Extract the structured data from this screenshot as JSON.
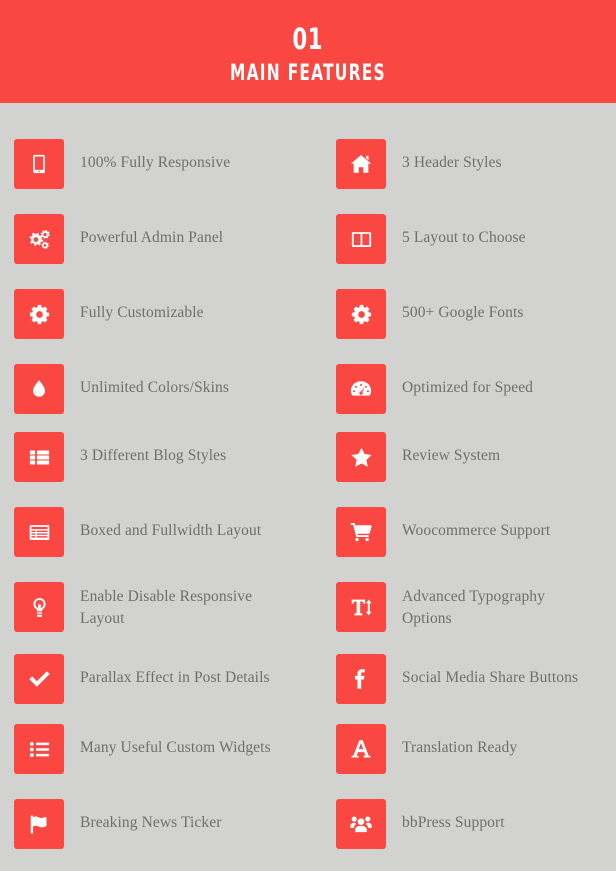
{
  "header": {
    "number": "01",
    "title": "MAIN FEATURES",
    "background_color": "#fb4742",
    "text_color": "#ffffff"
  },
  "theme": {
    "page_background": "#d2d2d0",
    "accent": "#fb4742",
    "label_color": "#6f6f6f"
  },
  "features": {
    "left_column": [
      {
        "label": "100% Fully Responsive",
        "icon": "tablet-icon",
        "two_line": false
      },
      {
        "label": "Powerful Admin Panel",
        "icon": "cogs-icon",
        "two_line": false
      },
      {
        "label": "Fully Customizable",
        "icon": "gear-icon",
        "two_line": false
      },
      {
        "label": "Unlimited Colors/Skins",
        "icon": "droplet-icon",
        "two_line": false
      },
      {
        "label": "3 Different Blog Styles",
        "icon": "list-blocks-icon",
        "two_line": false
      },
      {
        "label": "Boxed and Fullwidth Layout",
        "icon": "list-panel-icon",
        "two_line": false
      },
      {
        "label": "Enable Disable Responsive\nLayout",
        "icon": "lightbulb-icon",
        "two_line": true
      },
      {
        "label": "Parallax Effect in Post Details",
        "icon": "check-icon",
        "two_line": false
      },
      {
        "label": "Many Useful Custom Widgets",
        "icon": "list-bullets-icon",
        "two_line": false
      },
      {
        "label": "Breaking News Ticker",
        "icon": "flag-icon",
        "two_line": false
      }
    ],
    "right_column": [
      {
        "label": "3 Header Styles",
        "icon": "home-icon",
        "two_line": false
      },
      {
        "label": "5 Layout to Choose",
        "icon": "columns-icon",
        "two_line": false
      },
      {
        "label": "500+ Google Fonts",
        "icon": "gear-icon",
        "two_line": false
      },
      {
        "label": "Optimized for Speed",
        "icon": "dashboard-icon",
        "two_line": false
      },
      {
        "label": "Review System",
        "icon": "star-icon",
        "two_line": false
      },
      {
        "label": "Woocommerce Support",
        "icon": "shopping-cart-icon",
        "two_line": false
      },
      {
        "label": "Advanced Typography\nOptions",
        "icon": "text-height-icon",
        "two_line": true
      },
      {
        "label": "Social Media Share Buttons",
        "icon": "facebook-icon",
        "two_line": false
      },
      {
        "label": "Translation Ready",
        "icon": "letter-a-icon",
        "two_line": false
      },
      {
        "label": "bbPress Support",
        "icon": "group-users-icon",
        "two_line": false
      }
    ]
  }
}
